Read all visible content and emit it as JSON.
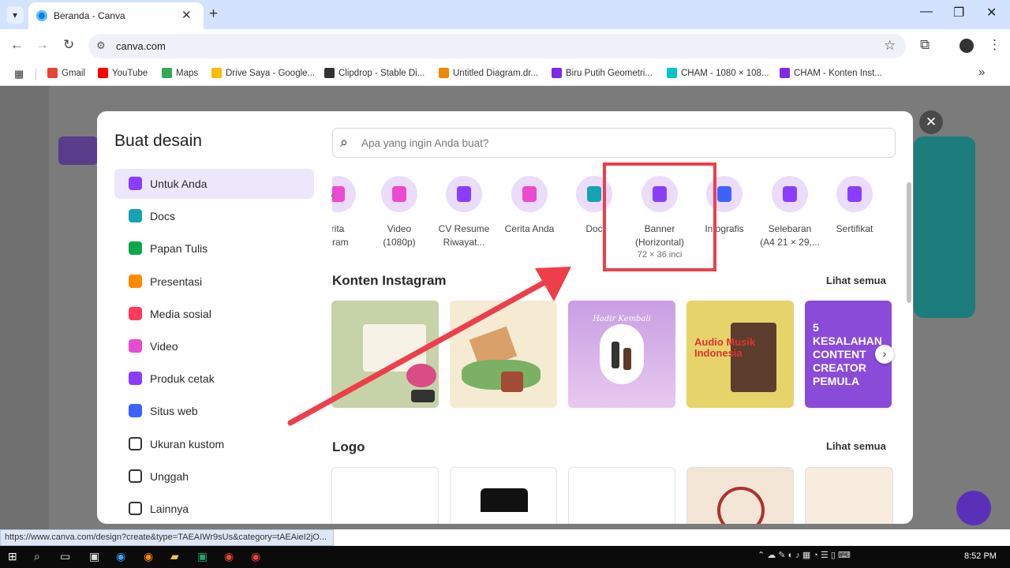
{
  "browser": {
    "tab_title": "Beranda - Canva",
    "new_tab_symbol": "+",
    "close_symbol": "✕",
    "url": "canva.com",
    "bookmarks": [
      {
        "label": "Gmail",
        "color": "#ea4335"
      },
      {
        "label": "YouTube",
        "color": "#ff0000"
      },
      {
        "label": "Maps",
        "color": "#34a853"
      },
      {
        "label": "Drive Saya - Google...",
        "color": "#fbbc04"
      },
      {
        "label": "Clipdrop - Stable Di...",
        "color": "#333333"
      },
      {
        "label": "Untitled Diagram.dr...",
        "color": "#f08705"
      },
      {
        "label": "Biru Putih Geometri...",
        "color": "#7d2ae8"
      },
      {
        "label": "CHAM - 1080 × 108...",
        "color": "#00c4cc"
      },
      {
        "label": "CHAM - Konten Inst...",
        "color": "#7d2ae8"
      }
    ],
    "more_bookmarks": "»"
  },
  "modal": {
    "title": "Buat desain",
    "close_symbol": "✕",
    "search_placeholder": "Apa yang ingin Anda buat?",
    "sidebar": [
      {
        "label": "Untuk Anda",
        "icon": "sparkle-icon",
        "color": "#8b3dff"
      },
      {
        "label": "Docs",
        "icon": "docs-icon",
        "color": "#13a3b5"
      },
      {
        "label": "Papan Tulis",
        "icon": "whiteboard-icon",
        "color": "#0ba84a"
      },
      {
        "label": "Presentasi",
        "icon": "presentation-icon",
        "color": "#ff8a00"
      },
      {
        "label": "Media sosial",
        "icon": "heart-icon",
        "color": "#ff3b5c"
      },
      {
        "label": "Video",
        "icon": "video-icon",
        "color": "#e94bd0"
      },
      {
        "label": "Produk cetak",
        "icon": "print-icon",
        "color": "#8b3dff"
      },
      {
        "label": "Situs web",
        "icon": "website-icon",
        "color": "#3d63ff"
      },
      {
        "label": "Ukuran kustom",
        "icon": "custom-size-icon",
        "color": "#333333"
      },
      {
        "label": "Unggah",
        "icon": "upload-cloud-icon",
        "color": "#333333"
      },
      {
        "label": "Lainnya",
        "icon": "more-icon",
        "color": "#333333"
      }
    ],
    "categories": [
      {
        "l1": "rita",
        "l2": "gram",
        "color": "#e94bd0"
      },
      {
        "l1": "Video",
        "l2": "(1080p)",
        "color": "#e94bd0"
      },
      {
        "l1": "CV Resume",
        "l2": "Riwayat...",
        "color": "#8b3dff"
      },
      {
        "l1": "Cerita Anda",
        "l2": "",
        "color": "#e94bd0"
      },
      {
        "l1": "Doc",
        "l2": "",
        "color": "#13a3b5"
      },
      {
        "l1": "Banner",
        "l2": "(Horizontal)",
        "l3": "72 × 36 inci",
        "color": "#8b3dff"
      },
      {
        "l1": "Infografis",
        "l2": "",
        "color": "#3d63ff"
      },
      {
        "l1": "Selebaran",
        "l2": "(A4 21 × 29,...",
        "color": "#8b3dff"
      },
      {
        "l1": "Sertifikat",
        "l2": "",
        "color": "#8b3dff"
      }
    ],
    "section_instagram": "Konten Instagram",
    "section_logo": "Logo",
    "see_all": "Lihat semua",
    "thumb5_text": "5 KESALAHAN CONTENT CREATOR PEMULA",
    "thumb3_text": "Hadir Kembali",
    "thumb4_text": "Audio Musik Indonesia"
  },
  "status_url": "https://www.canva.com/design?create&type=TAEAIWr9sUs&category=tAEAieI2jO...",
  "taskbar": {
    "clock": "8:52 PM"
  }
}
